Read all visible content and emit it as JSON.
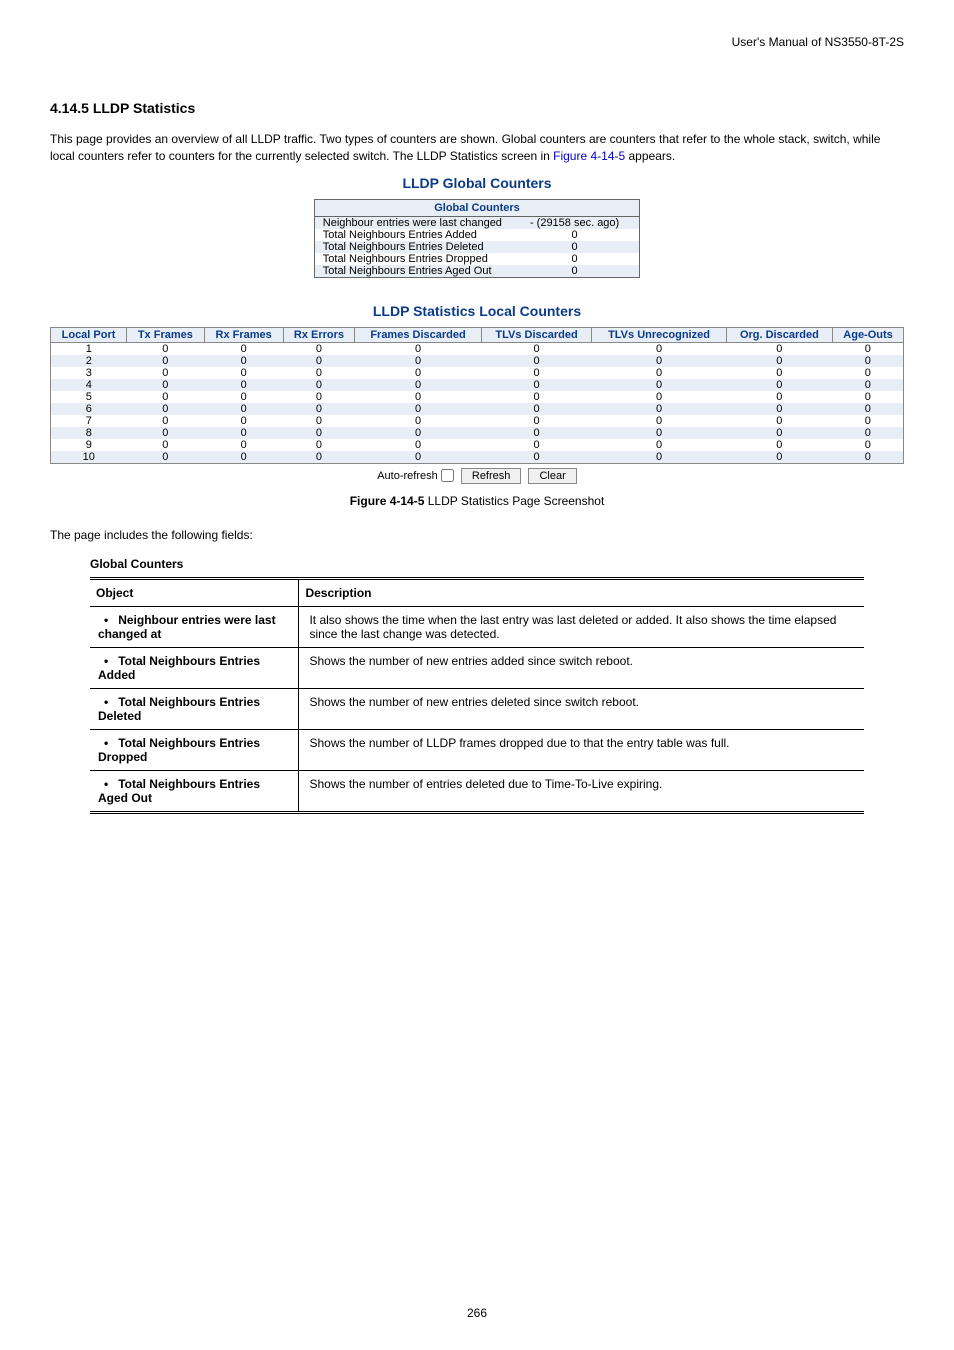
{
  "header": {
    "right": "User's Manual of NS3550-8T-2S"
  },
  "section_heading": "4.14.5 LLDP Statistics",
  "intro": {
    "part1": "This page provides an overview of all LLDP traffic. Two types of counters are shown. Global counters are counters that refer to the whole stack, switch, while local counters refer to counters for the currently selected switch. The LLDP Statistics screen in ",
    "figref": "Figure 4-14-5",
    "part2": " appears."
  },
  "titles": {
    "global": "LLDP Global Counters",
    "local": "LLDP Statistics Local Counters"
  },
  "global_table": {
    "header": "Global Counters",
    "rows": [
      {
        "label": "Neighbour entries were last changed",
        "value": "- (29158 sec. ago)"
      },
      {
        "label": "Total Neighbours Entries Added",
        "value": "0"
      },
      {
        "label": "Total Neighbours Entries Deleted",
        "value": "0"
      },
      {
        "label": "Total Neighbours Entries Dropped",
        "value": "0"
      },
      {
        "label": "Total Neighbours Entries Aged Out",
        "value": "0"
      }
    ]
  },
  "local_table": {
    "headers": [
      "Local Port",
      "Tx Frames",
      "Rx Frames",
      "Rx Errors",
      "Frames Discarded",
      "TLVs Discarded",
      "TLVs Unrecognized",
      "Org. Discarded",
      "Age-Outs"
    ],
    "rows": [
      [
        "1",
        "0",
        "0",
        "0",
        "0",
        "0",
        "0",
        "0",
        "0"
      ],
      [
        "2",
        "0",
        "0",
        "0",
        "0",
        "0",
        "0",
        "0",
        "0"
      ],
      [
        "3",
        "0",
        "0",
        "0",
        "0",
        "0",
        "0",
        "0",
        "0"
      ],
      [
        "4",
        "0",
        "0",
        "0",
        "0",
        "0",
        "0",
        "0",
        "0"
      ],
      [
        "5",
        "0",
        "0",
        "0",
        "0",
        "0",
        "0",
        "0",
        "0"
      ],
      [
        "6",
        "0",
        "0",
        "0",
        "0",
        "0",
        "0",
        "0",
        "0"
      ],
      [
        "7",
        "0",
        "0",
        "0",
        "0",
        "0",
        "0",
        "0",
        "0"
      ],
      [
        "8",
        "0",
        "0",
        "0",
        "0",
        "0",
        "0",
        "0",
        "0"
      ],
      [
        "9",
        "0",
        "0",
        "0",
        "0",
        "0",
        "0",
        "0",
        "0"
      ],
      [
        "10",
        "0",
        "0",
        "0",
        "0",
        "0",
        "0",
        "0",
        "0"
      ]
    ]
  },
  "controls": {
    "auto_refresh_label": "Auto-refresh",
    "refresh_btn": "Refresh",
    "clear_btn": "Clear"
  },
  "caption": {
    "prefix": "Figure 4-14-5 ",
    "text": "LLDP Statistics Page Screenshot"
  },
  "fields_intro": "The page includes the following fields:",
  "gc_caption": "Global Counters",
  "desc_table": {
    "head": {
      "object": "Object",
      "description": "Description"
    },
    "rows": [
      {
        "object": "Neighbour entries were last changed at",
        "description": "It also shows the time when the last entry was last deleted or added. It also shows the time elapsed since the last change was detected."
      },
      {
        "object": "Total Neighbours Entries Added",
        "description": "Shows the number of new entries added since switch reboot."
      },
      {
        "object": "Total Neighbours Entries Deleted",
        "description": "Shows the number of new entries deleted since switch reboot."
      },
      {
        "object": "Total Neighbours Entries Dropped",
        "description": "Shows the number of LLDP frames dropped due to that the entry table was full."
      },
      {
        "object": "Total Neighbours Entries Aged Out",
        "description": "Shows the number of entries deleted due to Time-To-Live expiring."
      }
    ]
  },
  "page_number": "266"
}
